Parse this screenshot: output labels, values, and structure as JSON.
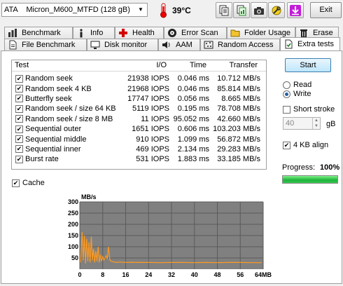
{
  "drive": {
    "selected": "ATA    Micron_M600_MTFD (128 gB)"
  },
  "temperature": "39°C",
  "toolbar": {
    "exit_label": "Exit"
  },
  "tabs_row1": [
    {
      "label": "Benchmark",
      "icon": "benchmark-icon"
    },
    {
      "label": "Info",
      "icon": "info-icon"
    },
    {
      "label": "Health",
      "icon": "health-cross-icon"
    },
    {
      "label": "Error Scan",
      "icon": "error-scan-icon"
    },
    {
      "label": "Folder Usage",
      "icon": "folder-icon"
    },
    {
      "label": "Erase",
      "icon": "erase-icon"
    }
  ],
  "tabs_row2": [
    {
      "label": "File Benchmark",
      "icon": "file-icon"
    },
    {
      "label": "Disk monitor",
      "icon": "monitor-icon"
    },
    {
      "label": "AAM",
      "icon": "speaker-icon"
    },
    {
      "label": "Random Access",
      "icon": "random-access-icon"
    },
    {
      "label": "Extra tests",
      "icon": "extra-tests-icon"
    }
  ],
  "table": {
    "headers": {
      "test": "Test",
      "io": "I/O",
      "time": "Time",
      "transfer": "Transfer"
    },
    "rows": [
      {
        "test": "Random seek",
        "io": "21938 IOPS",
        "time": "0.046 ms",
        "transfer": "10.712 MB/s"
      },
      {
        "test": "Random seek 4 KB",
        "io": "21968 IOPS",
        "time": "0.046 ms",
        "transfer": "85.814 MB/s"
      },
      {
        "test": "Butterfly seek",
        "io": "17747 IOPS",
        "time": "0.056 ms",
        "transfer": "8.665 MB/s"
      },
      {
        "test": "Random seek / size 64 KB",
        "io": "5119 IOPS",
        "time": "0.195 ms",
        "transfer": "78.708 MB/s"
      },
      {
        "test": "Random seek / size 8 MB",
        "io": "11 IOPS",
        "time": "95.052 ms",
        "transfer": "42.660 MB/s"
      },
      {
        "test": "Sequential outer",
        "io": "1651 IOPS",
        "time": "0.606 ms",
        "transfer": "103.203 MB/s"
      },
      {
        "test": "Sequential middle",
        "io": "910 IOPS",
        "time": "1.099 ms",
        "transfer": "56.872 MB/s"
      },
      {
        "test": "Sequential inner",
        "io": "469 IOPS",
        "time": "2.134 ms",
        "transfer": "29.283 MB/s"
      },
      {
        "test": "Burst rate",
        "io": "531 IOPS",
        "time": "1.883 ms",
        "transfer": "33.185 MB/s"
      }
    ]
  },
  "options": {
    "start_label": "Start",
    "read_label": "Read",
    "write_label": "Write",
    "mode_selected": "Write",
    "short_stroke_label": "Short stroke",
    "short_stroke_checked": false,
    "stroke_value": "40",
    "stroke_unit": "gB",
    "align_label": "4 KB align",
    "align_checked": true,
    "cache_label": "Cache",
    "cache_checked": true
  },
  "progress": {
    "label": "Progress:",
    "value_text": "100%",
    "fraction": 1.0,
    "color": "#2fbf45"
  },
  "chart_data": {
    "type": "line",
    "ylabel": "MB/s",
    "ylim": [
      0,
      300
    ],
    "xlim": [
      0,
      64
    ],
    "yticks": [
      "300",
      "250",
      "200",
      "150",
      "100",
      "50"
    ],
    "xticks": [
      "0",
      "8",
      "16",
      "24",
      "32",
      "40",
      "48",
      "56",
      "64MB"
    ],
    "background": "#808080",
    "line_color": "#ff9a1f",
    "series": [
      {
        "x": [
          0.3,
          0.8,
          1.2,
          1.6,
          2.0,
          2.4,
          2.8,
          3.2,
          3.6,
          4.0,
          4.4,
          4.8,
          5.2,
          5.6,
          6.0,
          6.4,
          6.8,
          7.2,
          7.6,
          8.0,
          8.4,
          8.8,
          9.2,
          9.6,
          10.0,
          10.5,
          11,
          12,
          13,
          14,
          16,
          18,
          20,
          24,
          28,
          32,
          36,
          40,
          44,
          48,
          52,
          56,
          60,
          63.5
        ],
        "y": [
          30,
          165,
          40,
          150,
          25,
          135,
          35,
          120,
          30,
          145,
          40,
          90,
          30,
          80,
          35,
          100,
          30,
          65,
          35,
          55,
          40,
          50,
          60,
          45,
          100,
          40,
          35,
          32,
          30,
          32,
          30,
          31,
          30,
          30,
          29,
          30,
          30,
          29,
          30,
          29,
          30,
          30,
          29,
          29
        ]
      }
    ]
  }
}
